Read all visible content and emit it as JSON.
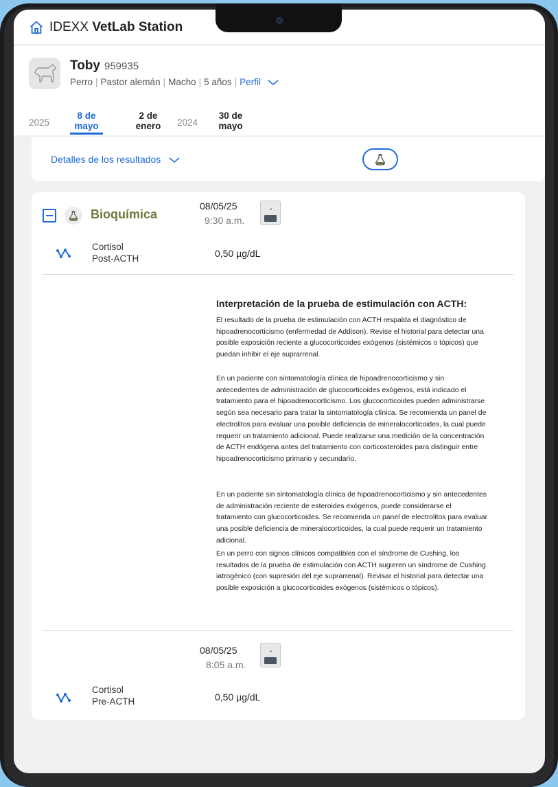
{
  "app": {
    "brand_prefix": "IDEXX",
    "brand_name": "VetLab Station"
  },
  "patient": {
    "name": "Toby",
    "id": "959935",
    "species": "Perro",
    "breed": "Pastor alemán",
    "sex": "Macho",
    "age": "5 años",
    "profile_link": "Perfil"
  },
  "timeline": {
    "tabs": [
      {
        "type": "year",
        "line1": "2025",
        "line2": ""
      },
      {
        "type": "date",
        "line1": "8 de",
        "line2": "mayo",
        "active": true
      },
      {
        "type": "date",
        "line1": "2 de",
        "line2": "enero",
        "active": false
      },
      {
        "type": "year",
        "line1": "2024",
        "line2": ""
      },
      {
        "type": "date",
        "line1": "30 de",
        "line2": "mayo",
        "active": false
      }
    ]
  },
  "details": {
    "label": "Detalles de los resultados"
  },
  "results": {
    "section_title": "Bioquímica",
    "runs": [
      {
        "date": "08/05/25",
        "time": "9:30 a.m.",
        "test_line1": "Cortisol",
        "test_line2": "Post-ACTH",
        "value": "0,50 µg/dL"
      },
      {
        "date": "08/05/25",
        "time": "8:05 a.m.",
        "test_line1": "Cortisol",
        "test_line2": "Pre-ACTH",
        "value": "0,50 µg/dL"
      }
    ],
    "interpretation_title": "Interpretación de la prueba de estimulación con ACTH:",
    "paragraphs": [
      "El resultado de la prueba de estimulación con ACTH respalda el diagnóstico de hipoadrenocorticismo (enfermedad de Addison). Revise el historial para detectar una posible exposición reciente a glucocorticoides exógenos (sistémicos o tópicos) que puedan inhibir el eje suprarrenal.",
      "En un paciente con sintomatología clínica de hipoadrenocorticismo y sin antecedentes de administración de glucocorticoides exógenos, está indicado el tratamiento para el hipoadrenocorticismo. Los glucocorticoides pueden administrarse según sea necesario para tratar la sintomatología clínica. Se recomienda un panel de electrolitos para evaluar una posible deficiencia de mineralocorticoides, la cual puede requerir un tratamiento adicional. Puede realizarse una medición de la concentración de ACTH endógena antes del tratamiento con corticosteroides para distinguir entre hipoadrenocorticismo primario y secundario.",
      "En un paciente sin sintomatología clínica de hipoadrenocorticismo y sin antecedentes de administración reciente de esteroides exógenos, puede considerarse el tratamiento con glucocorticoides. Se recomienda un panel de electrolitos para evaluar una posible deficiencia de mineralocorticoides, la cual puede requerir un tratamiento adicional.",
      "En un perro con signos clínicos compatibles con el síndrome de Cushing, los resultados de la prueba de estimulación con ACTH sugieren un síndrome de Cushing iatrogénico (con supresión del eje suprarrenal). Revisar el historial para detectar una posible exposición a glucocorticoides exógenos (sistémicos o tópicos)."
    ]
  },
  "colors": {
    "accent": "#1f6bd6",
    "section_title": "#6d7a3b",
    "background": "#8cc8ee"
  },
  "icons": {
    "home": "home-icon",
    "avatar": "dog-icon",
    "chevron": "chevron-down-icon",
    "flask": "flask-icon",
    "trend": "trend-icon",
    "analyzer": "analyzer-device-icon",
    "collapse": "collapse-icon"
  }
}
